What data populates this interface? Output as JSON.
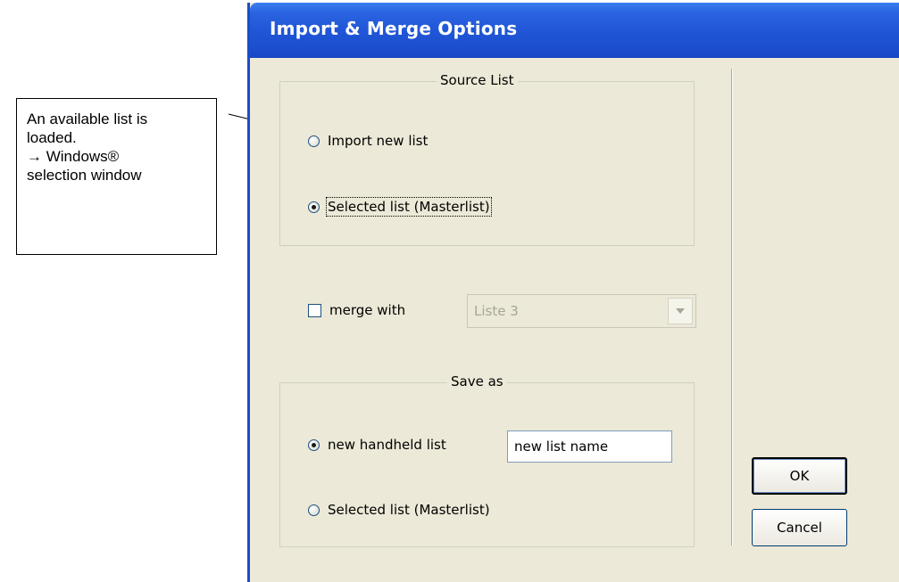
{
  "annotation": {
    "lines": [
      "An available list is",
      "loaded.",
      "→ Windows®",
      "selection window"
    ]
  },
  "dialog": {
    "title": "Import & Merge Options",
    "source_list": {
      "legend": "Source List",
      "options": [
        {
          "label": "Import new list",
          "checked": false
        },
        {
          "label": "Selected list (Masterlist)",
          "checked": true
        }
      ]
    },
    "merge": {
      "label": "merge with",
      "checked": false,
      "select_value": "Liste 3"
    },
    "save_as": {
      "legend": "Save as",
      "options": [
        {
          "label": "new handheld list",
          "checked": true
        },
        {
          "label": "Selected list (Masterlist)",
          "checked": false
        }
      ],
      "name_value": "new list name"
    },
    "buttons": {
      "ok": "OK",
      "cancel": "Cancel"
    }
  },
  "colors": {
    "titlebar": "#1f55d6",
    "dialog_bg": "#ece9d8"
  }
}
